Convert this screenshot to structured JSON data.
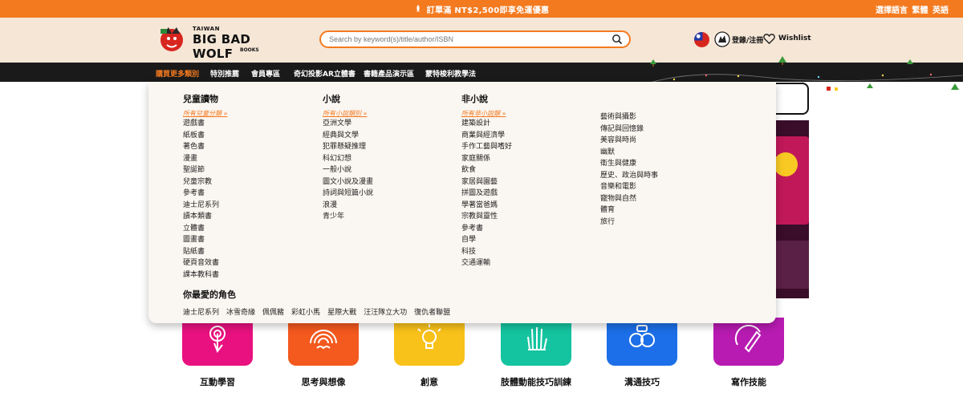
{
  "promo": {
    "message": "訂單滿 NT$2,500即享免運優惠",
    "language_prefix": "選擇語言",
    "language_traditional": "繁體",
    "language_english": "英語"
  },
  "header": {
    "logo_small": "TAIWAN",
    "logo_big": "BIG BAD WOLF",
    "logo_books": "BOOKS",
    "search_placeholder": "Search by keyword(s)/title/author/ISBN",
    "login_label": "登錄/注冊",
    "wishlist_label": "Wishlist"
  },
  "nav": {
    "items": [
      "購買更多類別",
      "特別推薦",
      "會員專區",
      "奇幻投影AR立體書",
      "書籍產品演示區",
      "蒙特梭利教學法"
    ]
  },
  "menu": {
    "columns": [
      {
        "title": "兒童讀物",
        "all_link": "所有兒童分類 »",
        "items": [
          "遊戲書",
          "紙板書",
          "著色書",
          "漫畫",
          "聖誕節",
          "兒童宗教",
          "參考書",
          "迪士尼系列",
          "讀本類書",
          "立體書",
          "圖畫書",
          "貼紙書",
          "硬頁音效書",
          "課本教科書"
        ]
      },
      {
        "title": "小說",
        "all_link": "所有小說類別 »",
        "items": [
          "亞洲文學",
          "經典與文學",
          "犯罪懸疑推理",
          "科幻幻想",
          "一般小說",
          "圖文小說及漫畫",
          "詩詞與短篇小說",
          "浪漫",
          "青少年"
        ]
      },
      {
        "title": "非小說",
        "all_link": "所有非小說類 »",
        "items": [
          "建築設計",
          "商業與經濟學",
          "手作工藝與嗜好",
          "家庭關係",
          "飲食",
          "家居與園藝",
          "拼圖及遊戲",
          "學著當爸媽",
          "宗教與靈性",
          "參考書",
          "自學",
          "科技",
          "交通運輸"
        ]
      }
    ],
    "extra_column": [
      "藝術與攝影",
      "傳記與回憶錄",
      "美容與時尚",
      "幽默",
      "衛生與健康",
      "歷史、政治與時事",
      "音樂和電影",
      "寵物與自然",
      "體育",
      "旅行"
    ],
    "favorites_title": "你最愛的角色",
    "favorites": [
      "迪士尼系列",
      "冰雪奇緣",
      "佩佩豬",
      "彩虹小馬",
      "星際大戰",
      "汪汪隊立大功",
      "復仇者聯盟"
    ]
  },
  "tiles": [
    {
      "label": "互動學習",
      "color": "#e8117f"
    },
    {
      "label": "思考與想像",
      "color": "#f4591e"
    },
    {
      "label": "創意",
      "color": "#f9c21a"
    },
    {
      "label": "肢體動能技巧訓練",
      "color": "#14c4a0"
    },
    {
      "label": "溝通技巧",
      "color": "#1c6fe8"
    },
    {
      "label": "寫作技能",
      "color": "#b71bb1"
    }
  ],
  "colors": {
    "accent": "#f47a20",
    "nav_bg": "#1a1a1a",
    "header_bg": "#f5e6d6"
  }
}
